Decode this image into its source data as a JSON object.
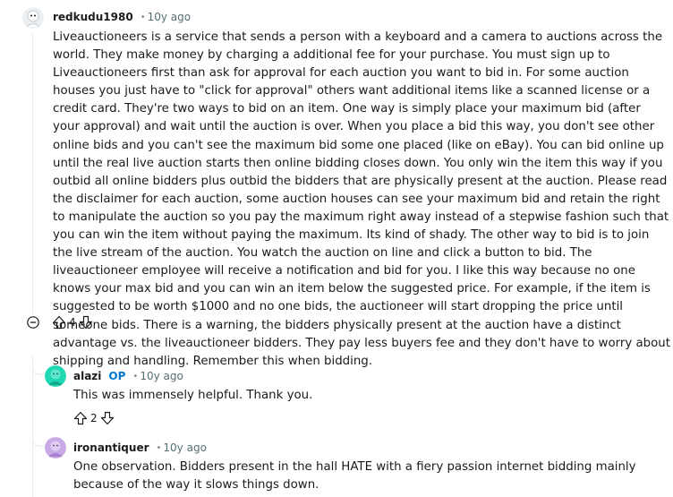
{
  "comments": [
    {
      "author": "redkudu1980",
      "time": "10y ago",
      "body": "Liveauctioneers is a service that sends a person with a keyboard and a camera to auctions across the world. They make money by charging a additional fee for your purchase. You must sign up to Liveauctioneers first than ask for approval for each auction you want to bid in. For some auction houses you just have to \"click for approval\" others want additional items like a scanned license or a credit card. They're two ways to bid on an item. One way is simply place your maximum bid (after your approval) and wait until the auction is over. When you place a bid this way, you don't see other online bids and you can't see the maximum bid some one placed (like on eBay). You can bid online up until the real live auction starts then online bidding closes down. You only win the item this way if you outbid all online bidders plus outbid the bidders that are physically present at the auction. Please read the disclaimer for each auction, some auction houses can see your maximum bid and retain the right to manipulate the auction so you pay the maximum right away instead of a stepwise fashion such that you can win the item without paying the maximum. Its kind of shady. The other way to bid is to join the live stream of the auction. You watch the auction on line and click a button to bid. The liveauctioneer employee will receive a notification and bid for you. I like this way because no one knows your max bid and you can win an item below the suggested price. For example, if the item is suggested to be worth $1000 and no one bids, the auctioneer will start dropping the price until someone bids. There is a warning, the bidders physically present at the auction have a distinct advantage vs. the liveauctioneer bidders. They pay less buyers fee and they don't have to worry about shipping and handling. Remember this when bidding.",
      "votes": "4"
    },
    {
      "author": "alazi",
      "op_tag": "OP",
      "time": "10y ago",
      "body": "This was immensely helpful. Thank you.",
      "votes": "2"
    },
    {
      "author": "ironantiquer",
      "time": "10y ago",
      "body": "One observation. Bidders present in the hall HATE with a fiery passion internet bidding mainly because of the way it slows things down."
    }
  ],
  "colors": {
    "op": "#0079d3",
    "meta": "#576f76",
    "thread_line": "#e5ebee",
    "avatar_alazi": "#1fd8b4",
    "avatar_iron": "#c9a9e6"
  }
}
